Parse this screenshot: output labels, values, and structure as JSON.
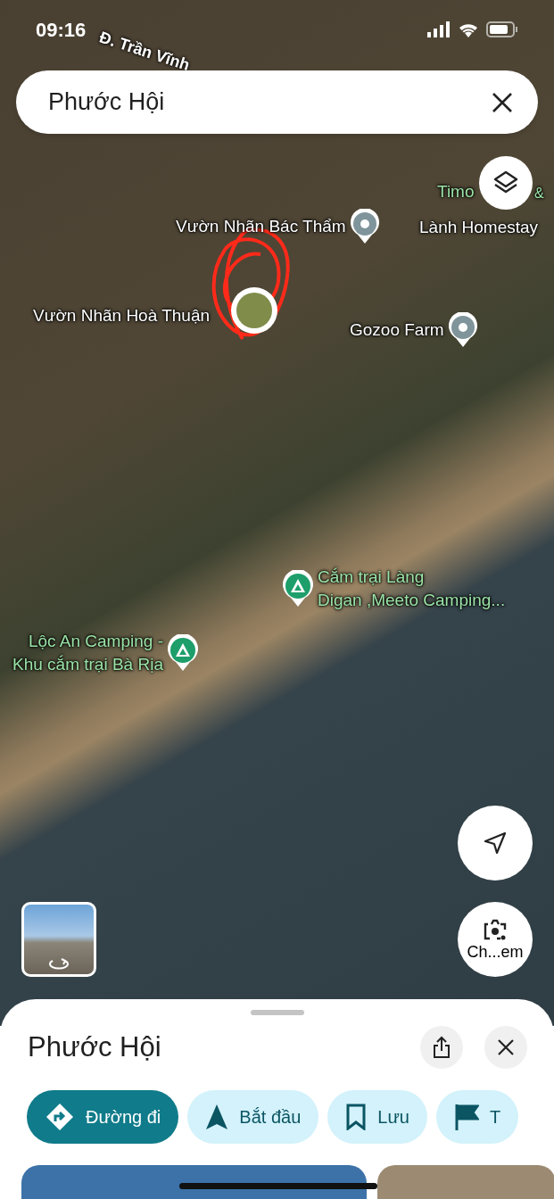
{
  "status_bar": {
    "time": "09:16"
  },
  "search": {
    "value": "Phước Hội"
  },
  "map": {
    "road_label": "Đ. Trần Vĩnh",
    "labels": [
      {
        "kind": "text",
        "lines": [
          "Timo"
        ],
        "color": "#9be3a6"
      },
      {
        "kind": "text",
        "lines": [
          "&"
        ],
        "color": "#9be3a6"
      },
      {
        "kind": "place",
        "lines": [
          "Vườn Nhãn Bác Thẩm"
        ],
        "color": "#ffffff"
      },
      {
        "kind": "text",
        "lines": [
          "Lành Homestay"
        ],
        "color": "#ffffff"
      },
      {
        "kind": "text",
        "lines": [
          "Vườn Nhãn Hoà Thuận"
        ],
        "color": "#ffffff"
      },
      {
        "kind": "place",
        "lines": [
          "Gozoo Farm"
        ],
        "color": "#ffffff"
      },
      {
        "kind": "camp",
        "lines": [
          "Cắm trại Làng",
          "Digan ,Meeto Camping..."
        ],
        "color": "#9be3a6"
      },
      {
        "kind": "camp",
        "lines": [
          "Lộc An Camping -",
          "Khu cắm trại Bà Rịa"
        ],
        "color": "#9be3a6"
      }
    ],
    "lens_label": "Ch...em"
  },
  "sheet": {
    "title": "Phước Hội",
    "chips": [
      {
        "kind": "directions",
        "label": "Đường đi",
        "selected": true
      },
      {
        "kind": "start",
        "label": "Bắt đầu",
        "selected": false
      },
      {
        "kind": "save",
        "label": "Lưu",
        "selected": false
      },
      {
        "kind": "flag",
        "label": "T",
        "selected": false
      }
    ]
  }
}
